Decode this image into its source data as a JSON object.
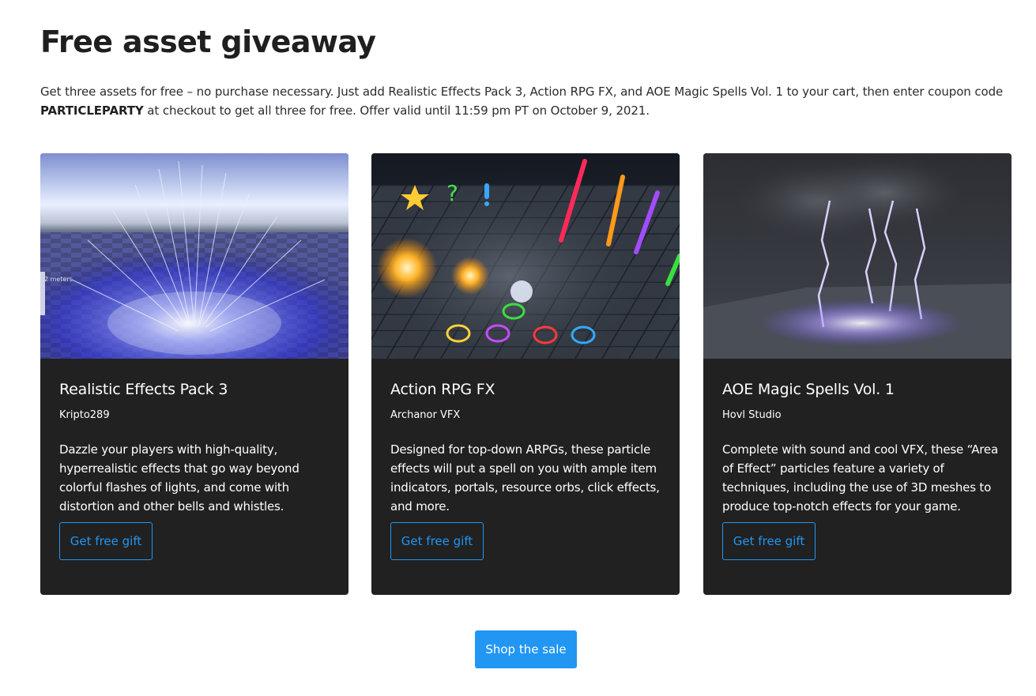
{
  "page": {
    "title": "Free asset giveaway",
    "intro_before": "Get three assets for free – no purchase necessary. Just add Realistic Effects Pack 3, Action RPG FX, and AOE Magic Spells Vol. 1 to your cart, then enter coupon code ",
    "coupon_code": "PARTICLEPARTY",
    "intro_after": " at checkout to get all three for free. Offer valid until 11:59 pm PT on October 9, 2021."
  },
  "cards": [
    {
      "title": "Realistic Effects Pack 3",
      "publisher": "Kripto289",
      "description": "Dazzle your players with high-quality, hyperrealistic effects that go way beyond colorful flashes of lights, and come with distortion and other bells and whistles.",
      "button_label": "Get free gift",
      "image_label": "2 meters"
    },
    {
      "title": "Action RPG FX",
      "publisher": "Archanor VFX",
      "description": "Designed for top-down ARPGs, these particle effects will put a spell on you  with ample item indicators, portals, resource orbs, click effects, and more.",
      "button_label": "Get free gift"
    },
    {
      "title": "AOE Magic Spells Vol. 1",
      "publisher": "Hovl Studio",
      "description": "Complete with sound and cool VFX, these “Area of Effect” particles feature a variety of techniques, including the use of 3D meshes to produce top-notch effects for your game.",
      "button_label": "Get free gift"
    }
  ],
  "footer": {
    "shop_label": "Shop the sale"
  },
  "colors": {
    "accent": "#2196f3",
    "card_background": "#212121",
    "page_background": "#ffffff"
  }
}
